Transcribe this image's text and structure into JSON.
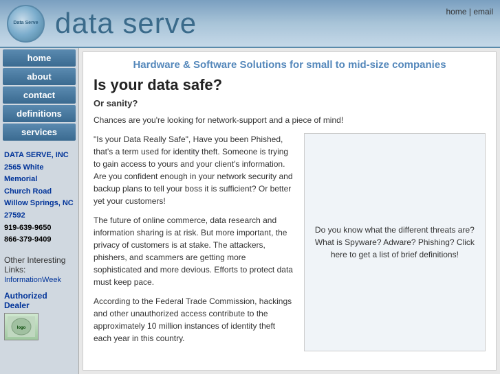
{
  "header": {
    "logo_text": "Data Serve",
    "site_title": "data serve",
    "nav_home": "home",
    "nav_email": "email",
    "nav_separator": " | "
  },
  "sidebar": {
    "nav_items": [
      {
        "label": "home",
        "id": "home"
      },
      {
        "label": "about",
        "id": "about"
      },
      {
        "label": "contact",
        "id": "contact"
      },
      {
        "label": "definitions",
        "id": "definitions"
      },
      {
        "label": "services",
        "id": "services"
      }
    ],
    "company_name": "DATA SERVE, INC",
    "address_line1": "2565 White Memorial",
    "address_line2": "Church Road",
    "address_line3": "Willow Springs, NC",
    "address_line4": "27592",
    "phone1": "919-639-9650",
    "phone2": "866-379-9409",
    "other_links_label": "Other Interesting Links:",
    "link1_label": "InformationWeek",
    "link1_href": "#",
    "authorized_dealer_label": "Authorized Dealer",
    "dealer_logo_alt": "dealer logo"
  },
  "content": {
    "headline": "Hardware & Software Solutions for small to mid-size companies",
    "main_title": "Is your data safe?",
    "sub_title": "Or sanity?",
    "para1": "Chances are you're looking for network-support and a piece of mind!",
    "para2": "\"Is your Data Really Safe\", Have you been Phished, that's a term used for identity theft. Someone is trying to gain access to yours and your client's information. Are you confident enough in your network security and backup plans to tell your boss it is sufficient? Or better yet your customers!",
    "para3": "The future of online commerce, data research and information sharing is at risk. But more important, the privacy of customers is at stake. The attackers, phishers, and scammers are getting more sophisticated and more devious. Efforts to protect data must keep pace.",
    "para4": "According to the Federal Trade Commission, hackings and other unauthorized access contribute to the approximately 10 million instances of identity theft each year in this country.",
    "sidebar_box": "Do you know what the different threats are? What is Spyware? Adware? Phishing? Click here to get a list of brief definitions!"
  }
}
